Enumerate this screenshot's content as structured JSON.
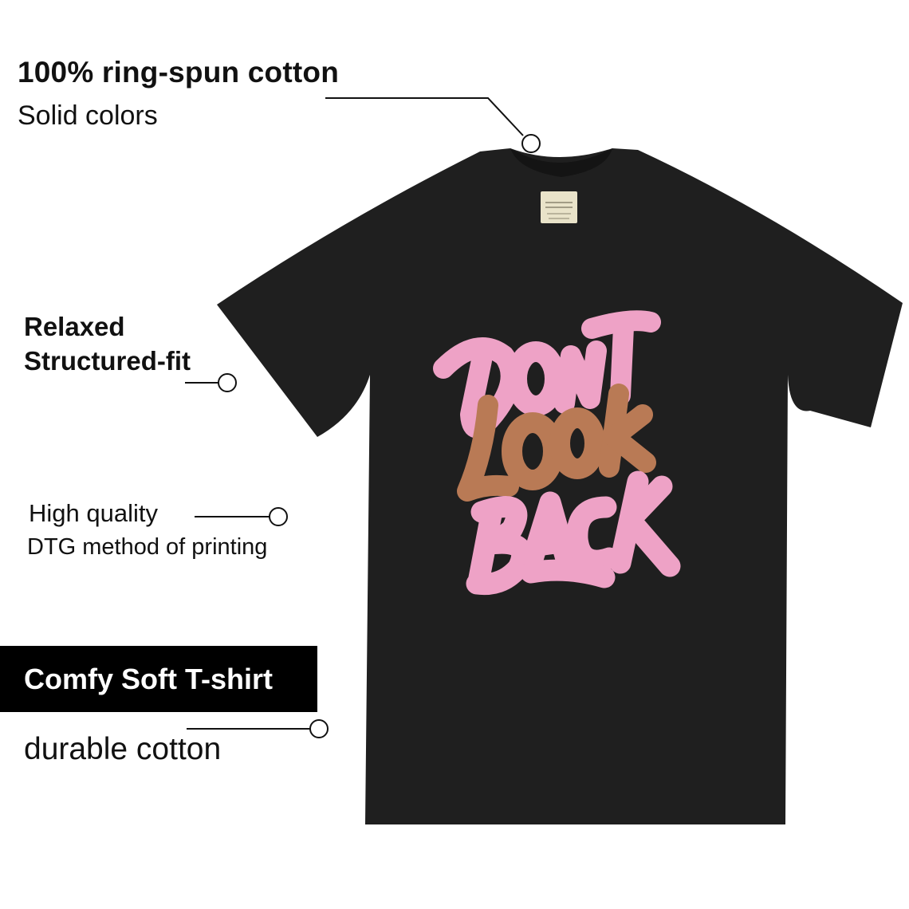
{
  "features": {
    "cotton": {
      "title": "100% ring-spun cotton",
      "subtitle": "Solid colors"
    },
    "fit": {
      "line1": "Relaxed",
      "line2": "Structured-fit"
    },
    "print": {
      "line1": "High quality",
      "line2": "DTG method of printing"
    },
    "soft": {
      "badge": "Comfy Soft T-shirt",
      "subtitle": "durable cotton"
    }
  },
  "shirt": {
    "label_brand": "COMFORT COLORS",
    "design_text": [
      "DONT",
      "LOOK",
      "BACK"
    ],
    "colors": {
      "body": "#1f1f1f",
      "pink": "#eea2c6",
      "brown": "#b97a55",
      "label": "#e9e3c9"
    }
  }
}
